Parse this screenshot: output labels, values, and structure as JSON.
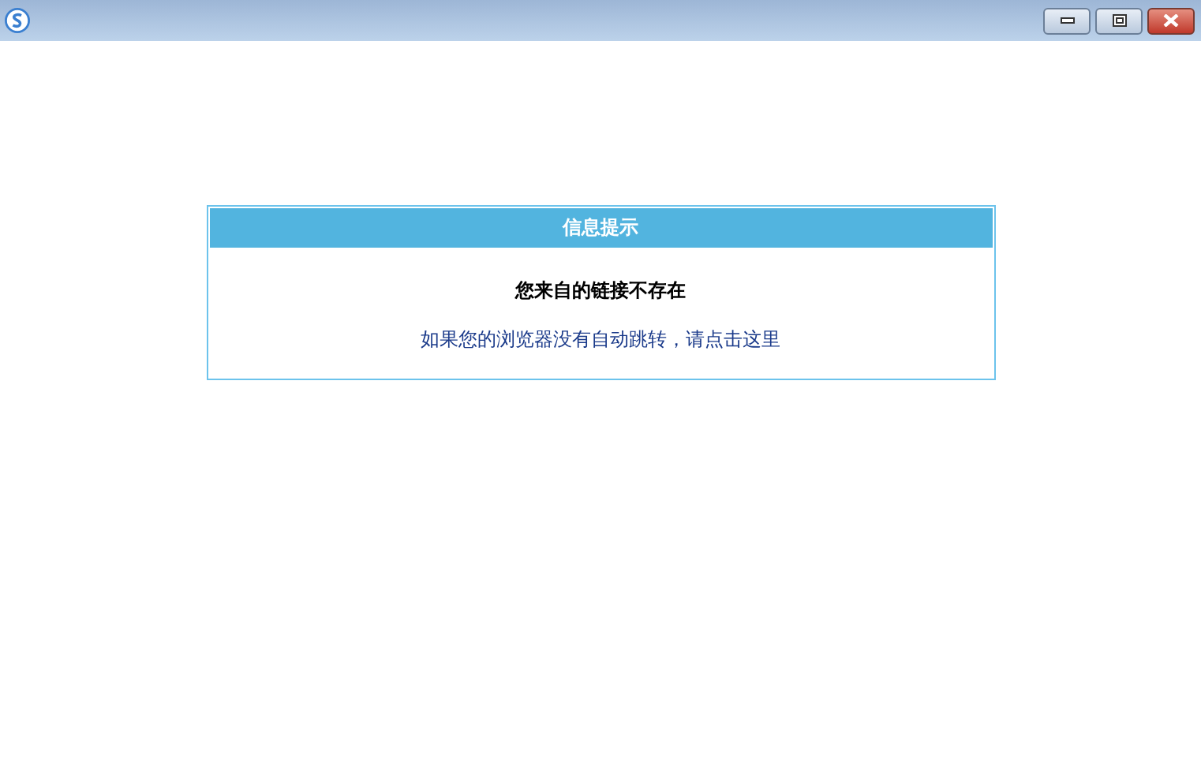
{
  "dialog": {
    "title": "信息提示",
    "message": "您来自的链接不存在",
    "link": "如果您的浏览器没有自动跳转，请点击这里"
  }
}
